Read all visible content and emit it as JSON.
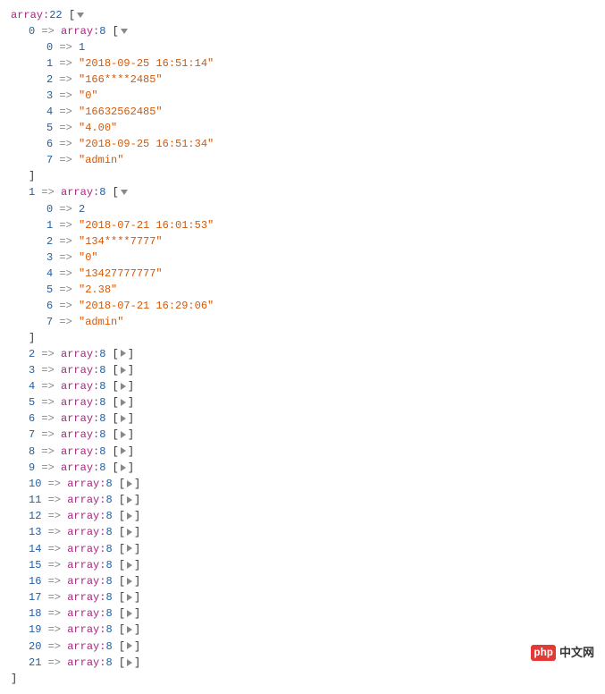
{
  "root": {
    "label": "array",
    "size": "22",
    "open_bracket": "[",
    "close_bracket": "]"
  },
  "expanded": [
    {
      "index": "0",
      "label": "array",
      "size": "8",
      "open_bracket": "[",
      "close_bracket": "]",
      "items": [
        {
          "key": "0",
          "value": "1",
          "is_string": false
        },
        {
          "key": "1",
          "value": "\"2018-09-25 16:51:14\"",
          "is_string": true
        },
        {
          "key": "2",
          "value": "\"166****2485\"",
          "is_string": true
        },
        {
          "key": "3",
          "value": "\"0\"",
          "is_string": true
        },
        {
          "key": "4",
          "value": "\"16632562485\"",
          "is_string": true
        },
        {
          "key": "5",
          "value": "\"4.00\"",
          "is_string": true
        },
        {
          "key": "6",
          "value": "\"2018-09-25 16:51:34\"",
          "is_string": true
        },
        {
          "key": "7",
          "value": "\"admin\"",
          "is_string": true
        }
      ]
    },
    {
      "index": "1",
      "label": "array",
      "size": "8",
      "open_bracket": "[",
      "close_bracket": "]",
      "items": [
        {
          "key": "0",
          "value": "2",
          "is_string": false
        },
        {
          "key": "1",
          "value": "\"2018-07-21 16:01:53\"",
          "is_string": true
        },
        {
          "key": "2",
          "value": "\"134****7777\"",
          "is_string": true
        },
        {
          "key": "3",
          "value": "\"0\"",
          "is_string": true
        },
        {
          "key": "4",
          "value": "\"13427777777\"",
          "is_string": true
        },
        {
          "key": "5",
          "value": "\"2.38\"",
          "is_string": true
        },
        {
          "key": "6",
          "value": "\"2018-07-21 16:29:06\"",
          "is_string": true
        },
        {
          "key": "7",
          "value": "\"admin\"",
          "is_string": true
        }
      ]
    }
  ],
  "collapsed": [
    {
      "index": "2",
      "label": "array",
      "size": "8"
    },
    {
      "index": "3",
      "label": "array",
      "size": "8"
    },
    {
      "index": "4",
      "label": "array",
      "size": "8"
    },
    {
      "index": "5",
      "label": "array",
      "size": "8"
    },
    {
      "index": "6",
      "label": "array",
      "size": "8"
    },
    {
      "index": "7",
      "label": "array",
      "size": "8"
    },
    {
      "index": "8",
      "label": "array",
      "size": "8"
    },
    {
      "index": "9",
      "label": "array",
      "size": "8"
    },
    {
      "index": "10",
      "label": "array",
      "size": "8"
    },
    {
      "index": "11",
      "label": "array",
      "size": "8"
    },
    {
      "index": "12",
      "label": "array",
      "size": "8"
    },
    {
      "index": "13",
      "label": "array",
      "size": "8"
    },
    {
      "index": "14",
      "label": "array",
      "size": "8"
    },
    {
      "index": "15",
      "label": "array",
      "size": "8"
    },
    {
      "index": "16",
      "label": "array",
      "size": "8"
    },
    {
      "index": "17",
      "label": "array",
      "size": "8"
    },
    {
      "index": "18",
      "label": "array",
      "size": "8"
    },
    {
      "index": "19",
      "label": "array",
      "size": "8"
    },
    {
      "index": "20",
      "label": "array",
      "size": "8"
    },
    {
      "index": "21",
      "label": "array",
      "size": "8"
    }
  ],
  "arrow_symbol": "=>",
  "watermark": {
    "p": "php",
    "text": "中文网"
  }
}
